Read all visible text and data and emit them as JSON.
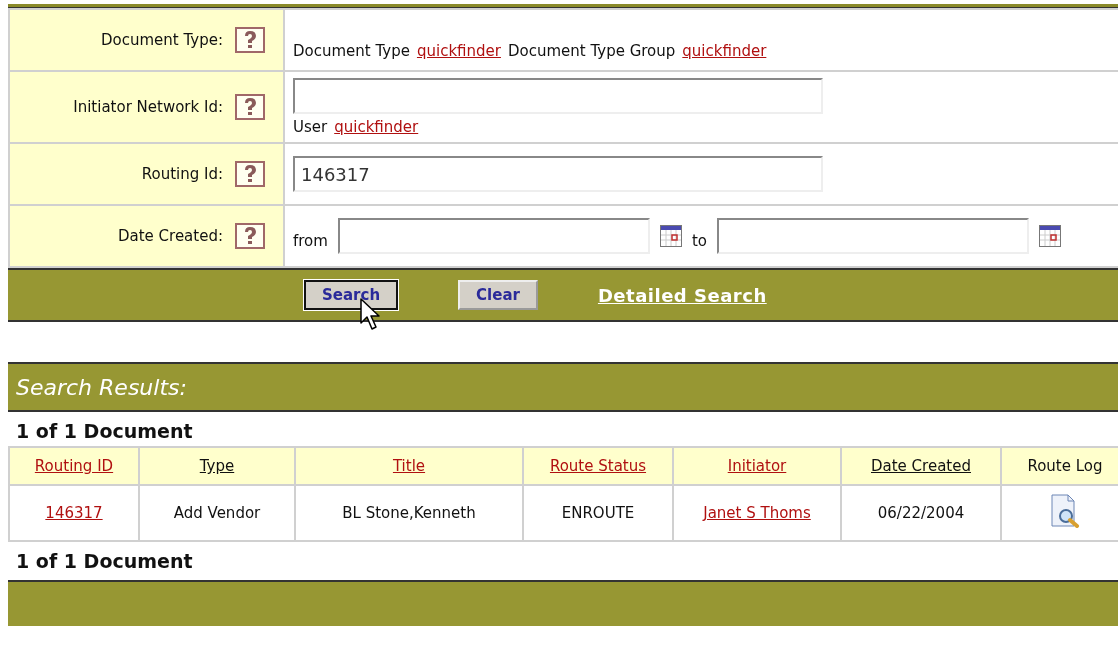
{
  "form": {
    "rows": [
      {
        "label": "Document Type:",
        "kind": "finder",
        "parts": [
          {
            "text": "Document Type",
            "link": "quickfinder"
          },
          {
            "text": "Document Type Group",
            "link": "quickfinder"
          }
        ]
      },
      {
        "label": "Initiator Network Id:",
        "kind": "input_finder",
        "value": "",
        "finder": {
          "text": "User",
          "link": "quickfinder"
        }
      },
      {
        "label": "Routing Id:",
        "kind": "input",
        "value": "146317"
      },
      {
        "label": "Date Created:",
        "kind": "date_range",
        "from_label": "from",
        "to_label": "to",
        "from_value": "",
        "to_value": ""
      }
    ]
  },
  "actions": {
    "search": "Search",
    "clear": "Clear",
    "detailed": "Detailed Search"
  },
  "results": {
    "title": "Search Results:",
    "count_top": "1 of 1  Document",
    "count_bottom": "1 of 1  Document",
    "columns": [
      {
        "label": "Routing ID",
        "kind": "link"
      },
      {
        "label": "Type",
        "kind": "sort"
      },
      {
        "label": "Title",
        "kind": "link"
      },
      {
        "label": "Route Status",
        "kind": "link"
      },
      {
        "label": "Initiator",
        "kind": "link"
      },
      {
        "label": "Date Created",
        "kind": "sort"
      },
      {
        "label": "Route Log",
        "kind": "plain"
      }
    ],
    "rows": [
      [
        {
          "kind": "link",
          "text": "146317"
        },
        {
          "kind": "text",
          "text": "Add Vendor"
        },
        {
          "kind": "text",
          "text": "BL Stone,Kenneth"
        },
        {
          "kind": "text",
          "text": "ENROUTE"
        },
        {
          "kind": "link",
          "text": "Janet S Thoms"
        },
        {
          "kind": "text",
          "text": "06/22/2004"
        },
        {
          "kind": "icon"
        }
      ]
    ]
  }
}
